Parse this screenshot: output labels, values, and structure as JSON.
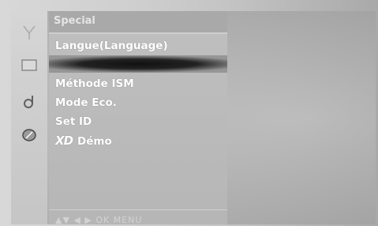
{
  "menu": {
    "title": "Special",
    "items": [
      {
        "label": "Langue(Language)"
      },
      {
        "label": ""
      },
      {
        "label": "Méthode ISM"
      },
      {
        "label": "Mode Eco."
      },
      {
        "label": "Set ID"
      },
      {
        "label": "Démo",
        "logo": "XD"
      }
    ]
  },
  "footer": {
    "arrows_ud": "▲▼",
    "arrows_lr": "◀ ▶",
    "ok": "OK",
    "menu": "MENU"
  },
  "icons": [
    "antenna-icon",
    "screen-icon",
    "audio-icon",
    "special-icon"
  ]
}
